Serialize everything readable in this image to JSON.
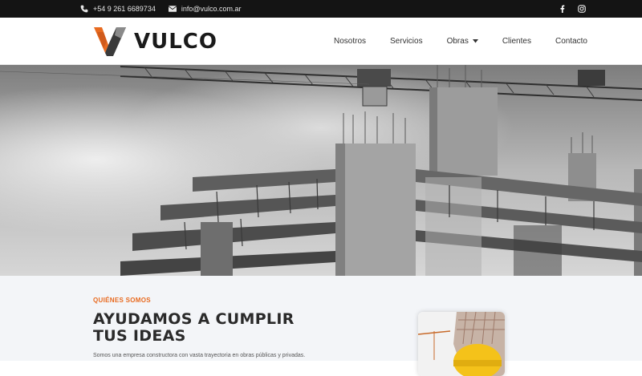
{
  "topbar": {
    "phone": "+54 9 261 6689734",
    "email": "info@vulco.com.ar",
    "icons": [
      "phone-icon",
      "envelope-icon",
      "facebook-icon",
      "instagram-icon"
    ]
  },
  "header": {
    "logo_text": "VULCO",
    "nav": [
      {
        "label": "Nosotros"
      },
      {
        "label": "Servicios"
      },
      {
        "label": "Obras"
      },
      {
        "label": "Clientes"
      },
      {
        "label": "Contacto"
      }
    ]
  },
  "about": {
    "eyebrow": "QUIÉNES SOMOS",
    "title": "AYUDAMOS A CUMPLIR TUS IDEAS",
    "description": "Somos una empresa constructora con vasta trayectoria en obras públicas y privadas."
  },
  "colors": {
    "accent": "#e86a1f",
    "topbar": "#141414",
    "section_bg": "#f3f5f8"
  }
}
